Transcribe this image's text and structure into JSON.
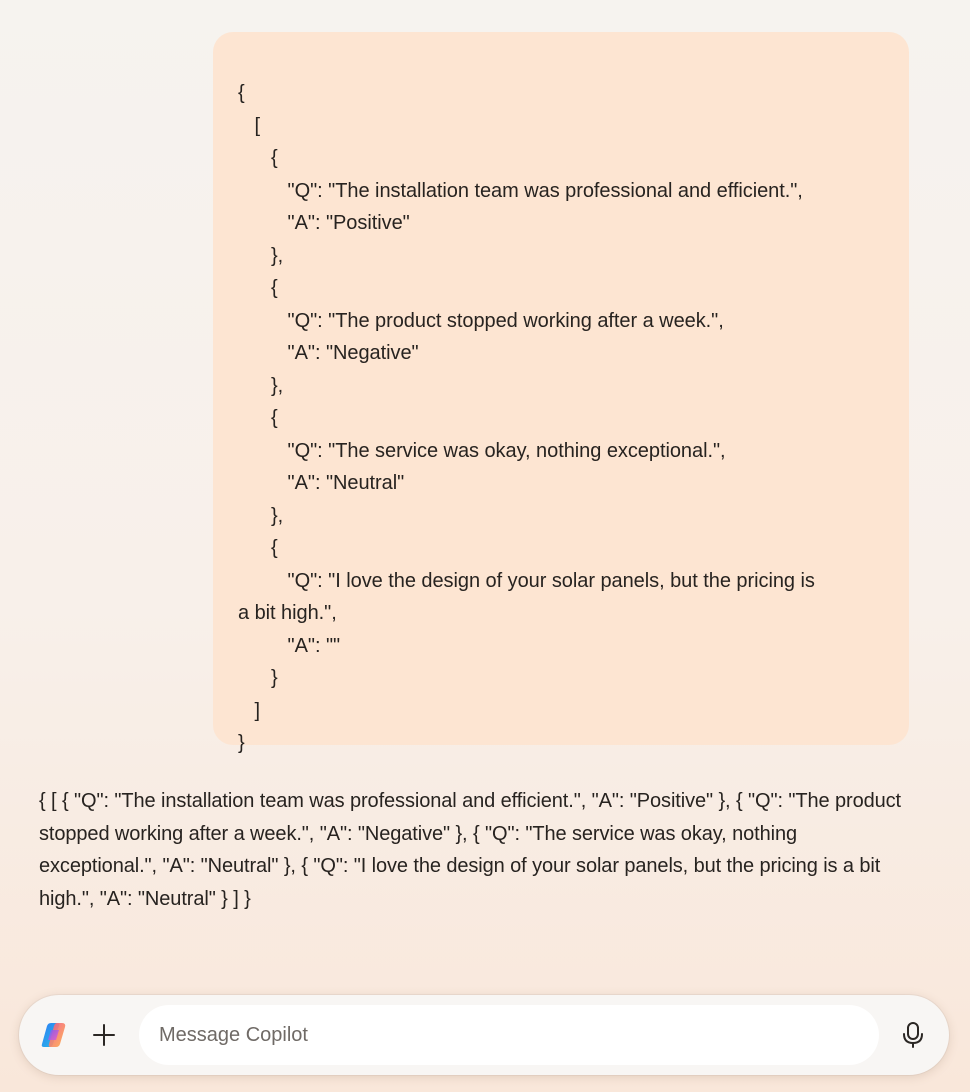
{
  "user_message": {
    "lines": [
      "{",
      "   [",
      "      {",
      "         \"Q\": \"The installation team was professional and efficient.\",",
      "         \"A\": \"Positive\"",
      "      },",
      "      {",
      "         \"Q\": \"The product stopped working after a week.\",",
      "         \"A\": \"Negative\"",
      "      },",
      "      {",
      "         \"Q\": \"The service was okay, nothing exceptional.\",",
      "         \"A\": \"Neutral\"",
      "      },",
      "      {",
      "         \"Q\": \"I love the design of your solar panels, but the pricing is",
      "a bit high.\",",
      "         \"A\": \"\"",
      "      }",
      "   ]",
      "}"
    ]
  },
  "assistant_reply": {
    "text": "{ [ { \"Q\": \"The installation team was professional and efficient.\", \"A\": \"Positive\" }, { \"Q\": \"The product stopped working after a week.\", \"A\": \"Negative\" }, { \"Q\": \"The service was okay, nothing exceptional.\", \"A\": \"Neutral\" }, { \"Q\": \"I love the design of your solar panels, but the pricing is a bit high.\", \"A\": \"Neutral\" } ] }"
  },
  "composer": {
    "placeholder": "Message Copilot",
    "logo_icon": "copilot-logo-icon",
    "add_icon": "plus-icon",
    "mic_icon": "microphone-icon"
  }
}
